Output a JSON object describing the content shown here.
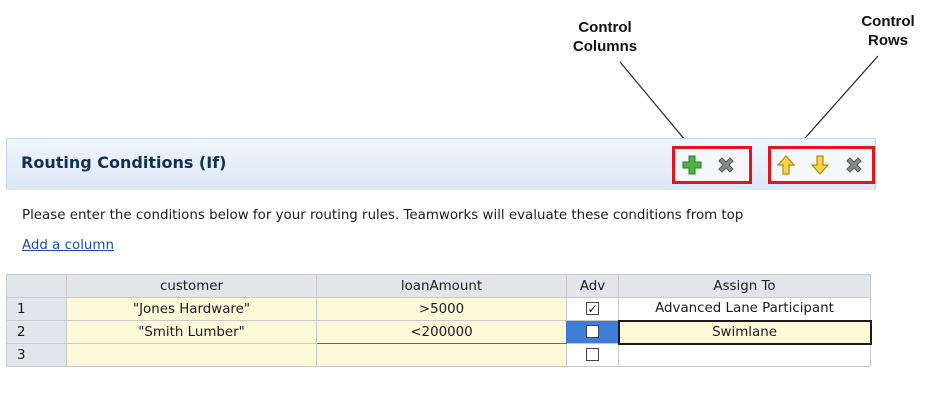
{
  "callouts": {
    "columns": "Control\nColumns",
    "rows": "Control\nRows"
  },
  "panel": {
    "title": "Routing Conditions (If)",
    "column_controls": [
      {
        "icon": "add-green-plus-icon",
        "color": "#3fa535"
      },
      {
        "icon": "delete-gray-x-icon",
        "color": "#7d7d7d"
      }
    ],
    "row_controls": [
      {
        "icon": "arrow-up-yellow-icon",
        "color": "#f2c21b"
      },
      {
        "icon": "arrow-down-yellow-icon",
        "color": "#f2c21b"
      },
      {
        "icon": "delete-gray-x-icon",
        "color": "#7d7d7d"
      }
    ]
  },
  "instructions": "Please enter the conditions below for your routing rules. Teamworks will evaluate these conditions from top",
  "add_column_link": "Add a column",
  "table": {
    "headers": [
      "",
      "customer",
      "loanAmount",
      "Adv",
      "Assign To"
    ],
    "rows": [
      {
        "num": "1",
        "customer": "\"Jones Hardware\"",
        "loanAmount": ">5000",
        "adv_checked": true,
        "assign": "Advanced Lane Participant"
      },
      {
        "num": "2",
        "customer": "\"Smith Lumber\"",
        "loanAmount": "<200000",
        "adv_checked": false,
        "assign": "Swimlane"
      },
      {
        "num": "3",
        "customer": "",
        "loanAmount": "",
        "adv_checked": false,
        "assign": ""
      }
    ]
  },
  "colors": {
    "highlight_border": "#e4141b",
    "cell_bg": "#fbf9d8",
    "selection_blue": "#3f7ed8",
    "link": "#1d4fa0"
  }
}
